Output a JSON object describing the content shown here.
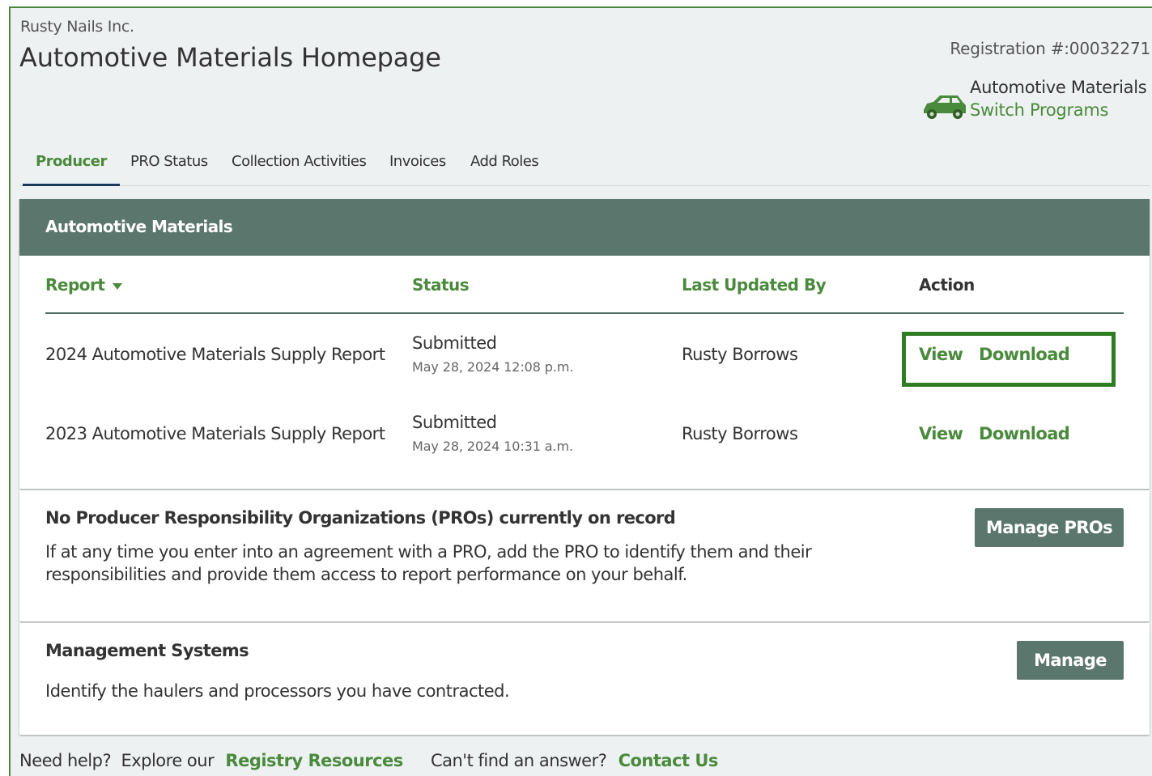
{
  "header": {
    "company": "Rusty Nails Inc.",
    "title": "Automotive Materials Homepage",
    "registration": "Registration #:00032271",
    "program_name": "Automotive Materials",
    "switch_label": "Switch Programs",
    "program_icon": "car-icon"
  },
  "tabs": [
    "Producer",
    "PRO Status",
    "Collection Activities",
    "Invoices",
    "Add Roles"
  ],
  "active_tab": "Producer",
  "reports_panel": {
    "title": "Automotive Materials",
    "columns": {
      "report": "Report",
      "status": "Status",
      "last_updated_by": "Last Updated By",
      "action": "Action"
    },
    "sort_icon": "sort-down-icon",
    "rows": [
      {
        "report": "2024 Automotive Materials Supply Report",
        "status": "Submitted",
        "date": "May 28, 2024 12:08 p.m.",
        "updated_by": "Rusty Borrows",
        "view": "View",
        "download": "Download"
      },
      {
        "report": "2023 Automotive Materials Supply Report",
        "status": "Submitted",
        "date": "May 28, 2024 10:31 a.m.",
        "updated_by": "Rusty Borrows",
        "view": "View",
        "download": "Download"
      }
    ]
  },
  "pros_panel": {
    "title": "No Producer Responsibility Organizations (PROs) currently on record",
    "body_line1": "If at any time you enter into an agreement with a PRO, add the PRO to identify them and their",
    "body_line2": "responsibilities and provide them access to report performance on your behalf.",
    "button": "Manage PROs"
  },
  "mgmt_panel": {
    "title": "Management Systems",
    "body": "Identify the haulers and processors you have contracted.",
    "button": "Manage"
  },
  "footer": {
    "help_text": "Need help?  Explore our",
    "resources_link": "Registry Resources",
    "cant_find": "Can't find an answer?",
    "contact_link": "Contact Us"
  },
  "colors": {
    "accent_green": "#4a8a3c",
    "panel_header": "#5b766c",
    "highlight_border": "#2e7d23",
    "page_bg": "#eef1f2"
  }
}
